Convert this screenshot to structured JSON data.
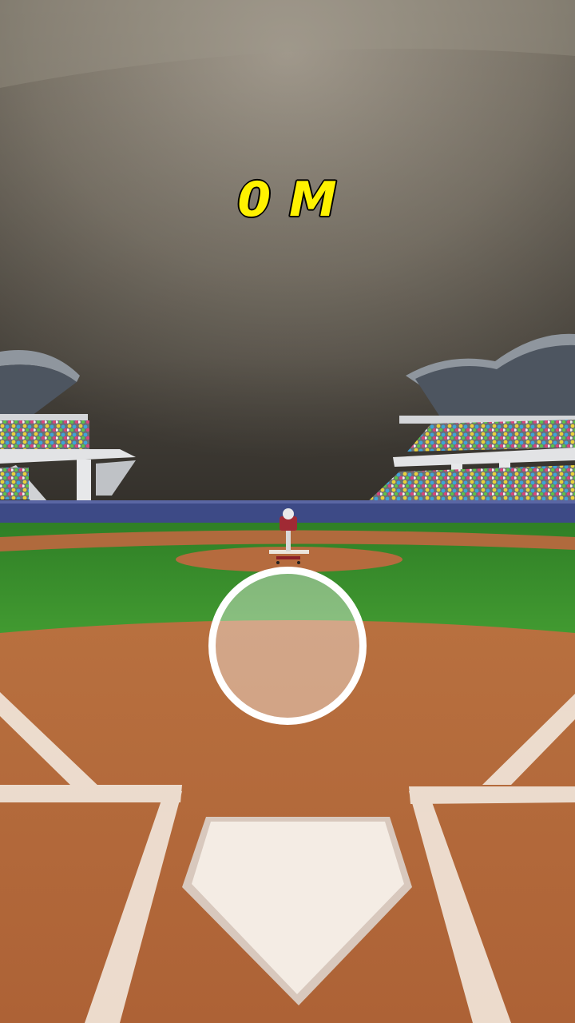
{
  "hud": {
    "distance_label": "0 M"
  },
  "scene": {
    "description_icons": [
      "stadium-stand-left",
      "stadium-stand-right",
      "pitching-machine",
      "home-plate",
      "pitchers-mound",
      "batters-box-lines"
    ],
    "colors": {
      "sky_top": "#8d8579",
      "sky_bottom": "#5e584e",
      "outfield_wall": "#3d4a86",
      "grass": "#3f9a2e",
      "dirt": "#b4683c",
      "chalk": "#f2e7dc",
      "distance_text": "#fff200"
    }
  },
  "aim_target": {
    "shape": "circle"
  }
}
